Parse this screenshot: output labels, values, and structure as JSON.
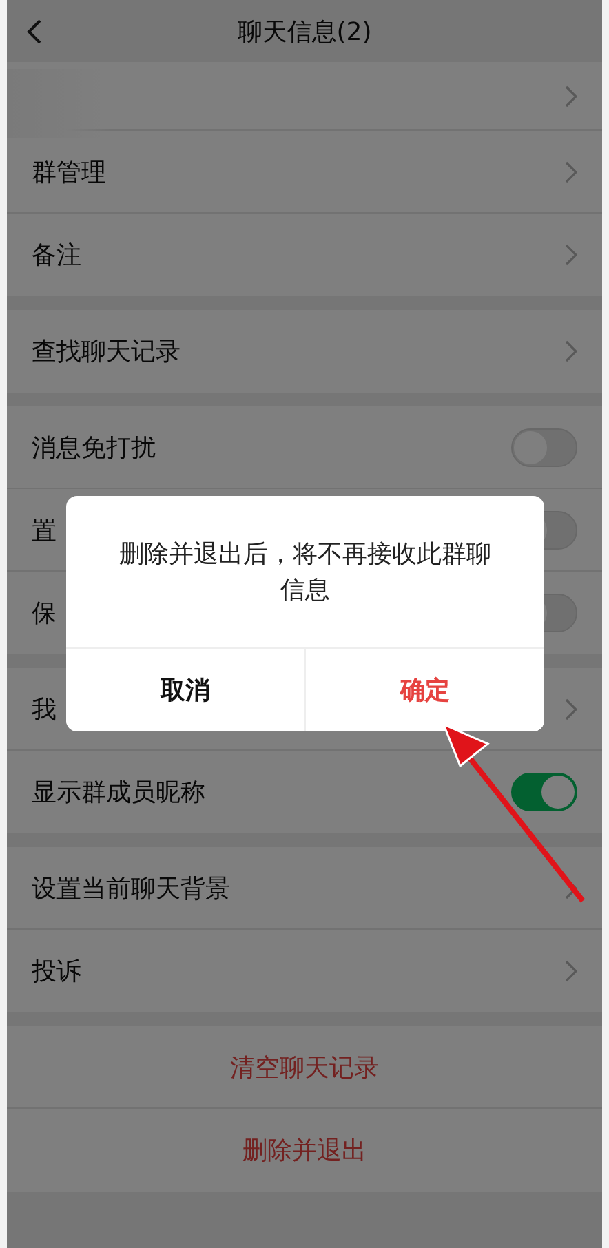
{
  "header": {
    "title": "聊天信息(2)"
  },
  "sections": [
    {
      "rows": [
        {
          "kind": "link"
        },
        {
          "kind": "link",
          "label": "群管理"
        },
        {
          "kind": "link",
          "label": "备注"
        }
      ]
    },
    {
      "rows": [
        {
          "kind": "link",
          "label": "查找聊天记录"
        }
      ]
    },
    {
      "rows": [
        {
          "kind": "switch",
          "label": "消息免打扰",
          "on": false
        },
        {
          "kind": "switch",
          "label": "置",
          "on": false
        },
        {
          "kind": "switch",
          "label": "保",
          "on": false
        }
      ]
    },
    {
      "rows": [
        {
          "kind": "link",
          "label": "我"
        },
        {
          "kind": "switch",
          "label": "显示群成员昵称",
          "on": true
        }
      ]
    },
    {
      "rows": [
        {
          "kind": "link",
          "label": "设置当前聊天背景"
        },
        {
          "kind": "link",
          "label": "投诉"
        }
      ]
    }
  ],
  "actions": [
    {
      "label": "清空聊天记录"
    },
    {
      "label": "删除并退出"
    }
  ],
  "dialog": {
    "message": "删除并退出后，将不再接收此群聊信息",
    "buttons": [
      {
        "kind": "cancel",
        "label": "取消"
      },
      {
        "kind": "confirm",
        "label": "确定"
      }
    ]
  }
}
